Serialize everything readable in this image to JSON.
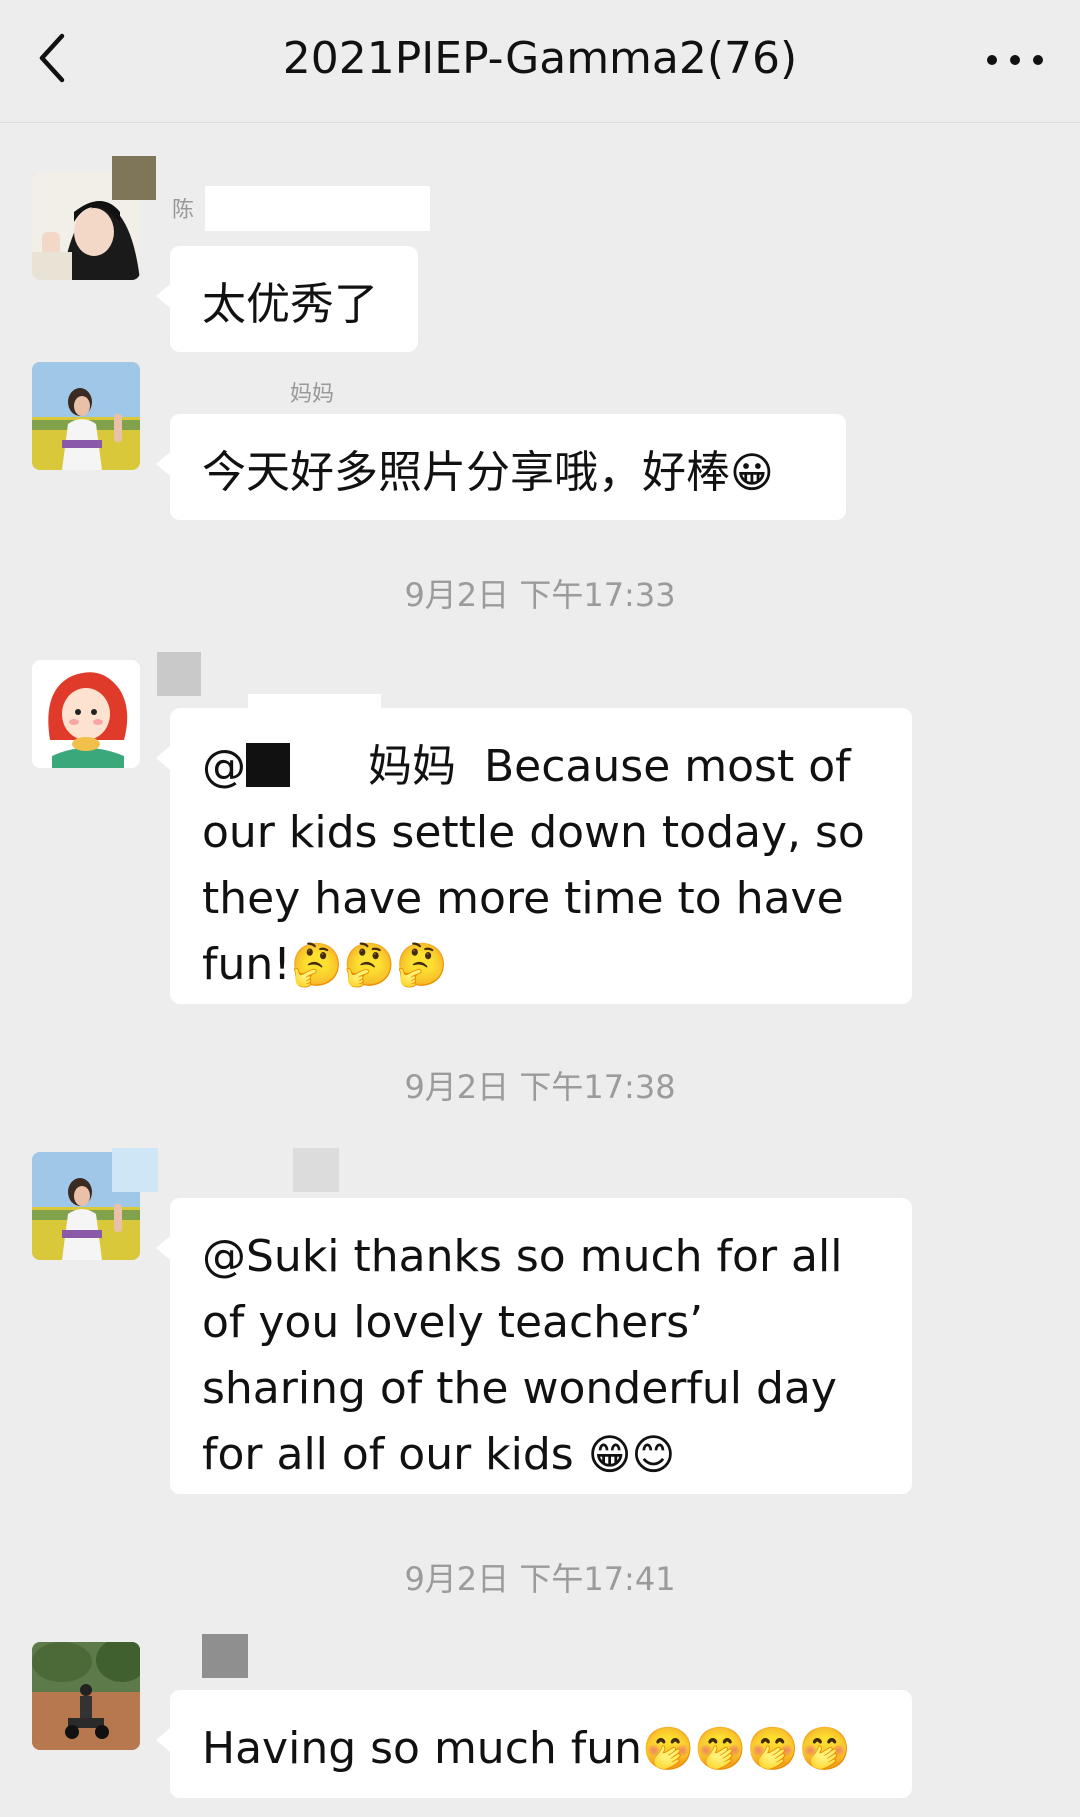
{
  "header": {
    "title": "2021PIEP-Gamma2(76)",
    "back_icon": "chevron-left-icon",
    "more_icon": "more-dots-icon"
  },
  "messages": [
    {
      "sender": "陈",
      "text": "太优秀了",
      "emoji": ""
    },
    {
      "sender": "妈妈",
      "text": "今天好多照片分享哦，好棒",
      "emoji": "😀"
    },
    {
      "time": "9月2日 下午17:33"
    },
    {
      "sender": "",
      "mention_prefix": "@",
      "mention_suffix": "妈妈",
      "text": "Because most of our kids settle down today, so they have more time to have fun!",
      "emoji": "🤔🤔🤔"
    },
    {
      "time": "9月2日 下午17:38"
    },
    {
      "sender": "",
      "text": "@Suki thanks so much for all of you lovely teachers’ sharing of the wonderful day for all of our kids ",
      "emoji": "😁😊"
    },
    {
      "time": "9月2日 下午17:41"
    },
    {
      "sender": "",
      "text": "Having so much fun",
      "emoji": "🤭🤭🤭🤭"
    }
  ],
  "colors": {
    "background": "#ededed",
    "bubble": "#ffffff",
    "timestamp": "#9b9b9b"
  }
}
